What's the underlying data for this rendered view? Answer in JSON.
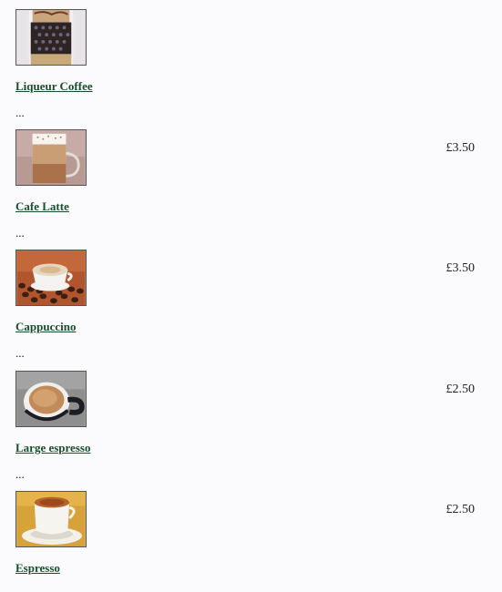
{
  "menu": {
    "items": [
      {
        "image": "liqueur-coffee-photo",
        "title": "Liqueur Coffee",
        "description": "...",
        "price": ""
      },
      {
        "image": "cafe-latte-photo",
        "title": "Cafe Latte",
        "description": "...",
        "price": "£3.50"
      },
      {
        "image": "cappuccino-photo",
        "title": "Cappuccino",
        "description": "...",
        "price": "£3.50"
      },
      {
        "image": "large-espresso-photo",
        "title": "Large espresso",
        "description": "...",
        "price": "£2.50"
      },
      {
        "image": "espresso-photo",
        "title": "Espresso",
        "description": "",
        "price": "£2.50"
      }
    ]
  }
}
